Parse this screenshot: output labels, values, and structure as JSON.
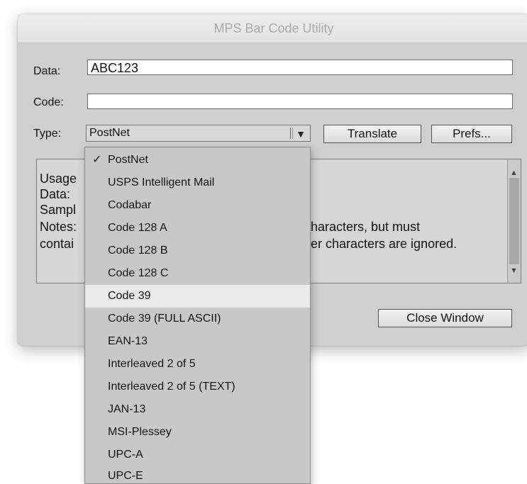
{
  "window": {
    "title": "MPS Bar Code Utility"
  },
  "form": {
    "data_label": "Data:",
    "data_value": "ABC123",
    "code_label": "Code:",
    "code_value": "",
    "type_label": "Type:",
    "type_selected": "PostNet",
    "translate_label": "Translate",
    "prefs_label": "Prefs...",
    "close_label": "Close Window"
  },
  "usage": {
    "visible_left": [
      "Usage",
      "Data:",
      "Sampl",
      "Notes:",
      "contai"
    ],
    "visible_right": [
      "haracters, but must",
      "er characters are ignored."
    ]
  },
  "menu": {
    "checkmark": "✓",
    "items": [
      "PostNet",
      "USPS Intelligent Mail",
      "Codabar",
      "Code 128 A",
      "Code 128 B",
      "Code 128 C",
      "Code 39",
      "Code 39 (FULL ASCII)",
      "EAN-13",
      "Interleaved 2 of 5",
      "Interleaved 2 of 5 (TEXT)",
      "JAN-13",
      "MSI-Plessey",
      "UPC-A",
      "UPC-E"
    ],
    "checked_item": "PostNet",
    "highlighted_item": "Code 39"
  },
  "colors": {
    "window_bg": "#cfcfcf",
    "title_text": "#a9a9a9",
    "menu_bg": "#c8c8c8",
    "menu_highlight": "#eaeaea"
  }
}
